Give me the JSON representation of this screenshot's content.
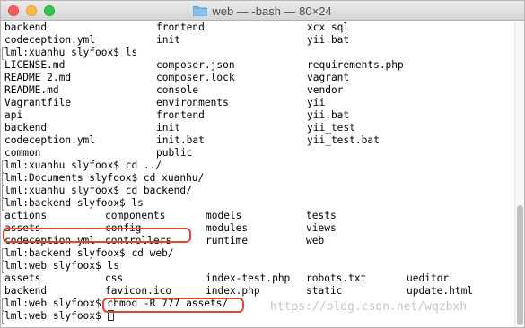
{
  "window": {
    "title": "web — -bash — 80×24",
    "icon": "folder-icon"
  },
  "terminal": {
    "lines": [
      {
        "kind": "grid3",
        "cells": [
          "backend",
          "frontend",
          "xcx.sql"
        ]
      },
      {
        "kind": "grid3",
        "cells": [
          "codeception.yml",
          "init",
          "yii.bat"
        ]
      },
      {
        "kind": "prompt",
        "text": "lml:xuanhu slyfoox$ ls"
      },
      {
        "kind": "grid3",
        "cells": [
          "LICENSE.md",
          "composer.json",
          "requirements.php"
        ]
      },
      {
        "kind": "grid3",
        "cells": [
          "README 2.md",
          "composer.lock",
          "vagrant"
        ]
      },
      {
        "kind": "grid3",
        "cells": [
          "README.md",
          "console",
          "vendor"
        ]
      },
      {
        "kind": "grid3",
        "cells": [
          "Vagrantfile",
          "environments",
          "yii"
        ]
      },
      {
        "kind": "grid3",
        "cells": [
          "api",
          "frontend",
          "yii.bat"
        ]
      },
      {
        "kind": "grid3",
        "cells": [
          "backend",
          "init",
          "yii_test"
        ]
      },
      {
        "kind": "grid3",
        "cells": [
          "codeception.yml",
          "init.bat",
          "yii_test.bat"
        ]
      },
      {
        "kind": "grid3",
        "cells": [
          "common",
          "public",
          ""
        ]
      },
      {
        "kind": "prompt",
        "text": "lml:xuanhu slyfoox$ cd ../"
      },
      {
        "kind": "prompt",
        "text": "lml:Documents slyfoox$ cd xuanhu/"
      },
      {
        "kind": "prompt",
        "text": "lml:xuanhu slyfoox$ cd backend/"
      },
      {
        "kind": "prompt",
        "text": "lml:backend slyfoox$ ls"
      },
      {
        "kind": "grid4",
        "cells": [
          "actions",
          "components",
          "models",
          "tests"
        ]
      },
      {
        "kind": "grid4",
        "cells": [
          "assets",
          "config",
          "modules",
          "views"
        ]
      },
      {
        "kind": "grid4",
        "cells": [
          "codeception.yml",
          "controllers",
          "runtime",
          "web"
        ]
      },
      {
        "kind": "prompt",
        "text": "lml:backend slyfoox$ cd web/"
      },
      {
        "kind": "prompt",
        "text": "lml:web slyfoox$ ls"
      },
      {
        "kind": "grid5",
        "cells": [
          "assets",
          "css",
          "index-test.php",
          "robots.txt",
          "ueditor"
        ]
      },
      {
        "kind": "grid5",
        "cells": [
          "backend",
          "favicon.ico",
          "index.php",
          "static",
          "update.html"
        ]
      },
      {
        "kind": "prompt",
        "text": "lml:web slyfoox$ chmod -R 777 assets/"
      },
      {
        "kind": "prompt-cursor",
        "text": "lml:web slyfoox$ "
      }
    ]
  },
  "watermark": "https://blog.csdn.net/wqzbxh",
  "colors": {
    "highlight": "#e8432b",
    "close": "#fc605c",
    "minimize": "#fdbc40",
    "maximize": "#34c84a"
  }
}
